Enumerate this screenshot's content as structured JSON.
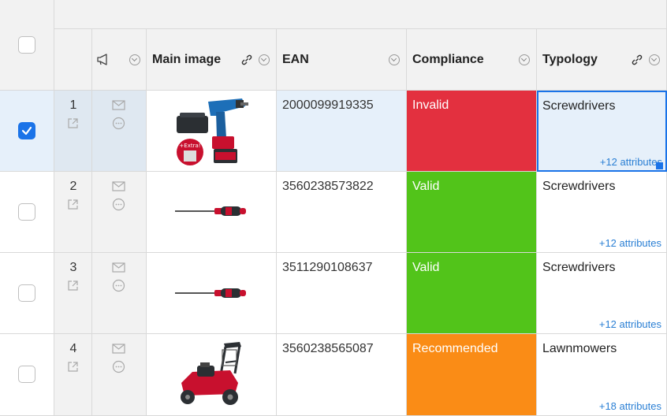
{
  "headers": {
    "main_image": "Main image",
    "ean": "EAN",
    "compliance": "Compliance",
    "typology": "Typology"
  },
  "icons": {
    "announcement": "megaphone-icon",
    "header_menu": "chevron-down-circle-icon",
    "link": "link-icon",
    "open": "open-external-icon",
    "mail": "envelope-icon",
    "comment": "comment-icon"
  },
  "colors": {
    "invalid": "#e3303f",
    "valid": "#52c41a",
    "recommended": "#fa8c16",
    "selected_row": "#e6f0fa",
    "accent": "#1a73e8"
  },
  "rows": [
    {
      "num": "1",
      "ean": "2000099919335",
      "compliance": "Invalid",
      "status": "invalid",
      "typology": "Screwdrivers",
      "attributes": "+12 attributes",
      "selected": true,
      "image": "cordless-drill-kit"
    },
    {
      "num": "2",
      "ean": "3560238573822",
      "compliance": "Valid",
      "status": "valid",
      "typology": "Screwdrivers",
      "attributes": "+12 attributes",
      "selected": false,
      "image": "screwdriver"
    },
    {
      "num": "3",
      "ean": "3511290108637",
      "compliance": "Valid",
      "status": "valid",
      "typology": "Screwdrivers",
      "attributes": "+12 attributes",
      "selected": false,
      "image": "screwdriver"
    },
    {
      "num": "4",
      "ean": "3560238565087",
      "compliance": "Recommended",
      "status": "recommended",
      "typology": "Lawnmowers",
      "attributes": "+18 attributes",
      "selected": false,
      "image": "lawnmower"
    }
  ]
}
